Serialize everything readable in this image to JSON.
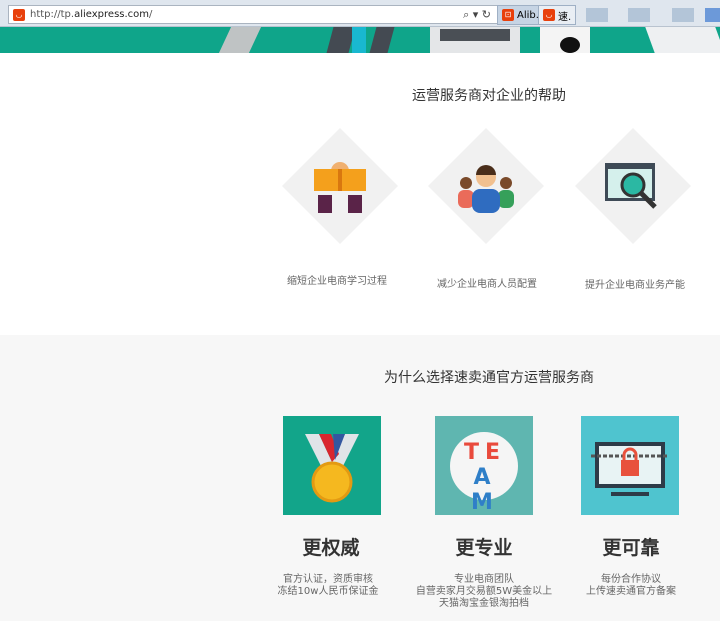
{
  "browser": {
    "url_prefix": "http://tp.",
    "url_domain": "aliexpress.com",
    "url_suffix": "/",
    "tools": "⌕ ▾ ↻",
    "tabs": [
      {
        "label": "Alib..."
      },
      {
        "label": "速."
      }
    ]
  },
  "section1": {
    "title": "运营服务商对企业的帮助",
    "items": [
      {
        "label": "缩短企业电商学习过程",
        "icon": "book-reader-icon"
      },
      {
        "label": "减少企业电商人员配置",
        "icon": "team-people-icon"
      },
      {
        "label": "提升企业电商业务产能",
        "icon": "chart-magnifier-icon"
      }
    ]
  },
  "section2": {
    "title": "为什么选择速卖通官方运营服务商",
    "items": [
      {
        "heading": "更权威",
        "lines": [
          "官方认证，资质审核",
          "冻结10w人民币保证金"
        ],
        "icon": "medal-icon"
      },
      {
        "heading": "更专业",
        "lines": [
          "专业电商团队",
          "自营卖家月交易额5W美金以上",
          "天猫淘宝金银淘拍档"
        ],
        "icon": "team-puzzle-icon",
        "team_letters": "TEAM"
      },
      {
        "heading": "更可靠",
        "lines": [
          "每份合作协议",
          "上传速卖通官方备案"
        ],
        "icon": "lock-screen-icon"
      }
    ]
  },
  "colors": {
    "teal": "#0fa58a",
    "orange": "#e8400c"
  }
}
